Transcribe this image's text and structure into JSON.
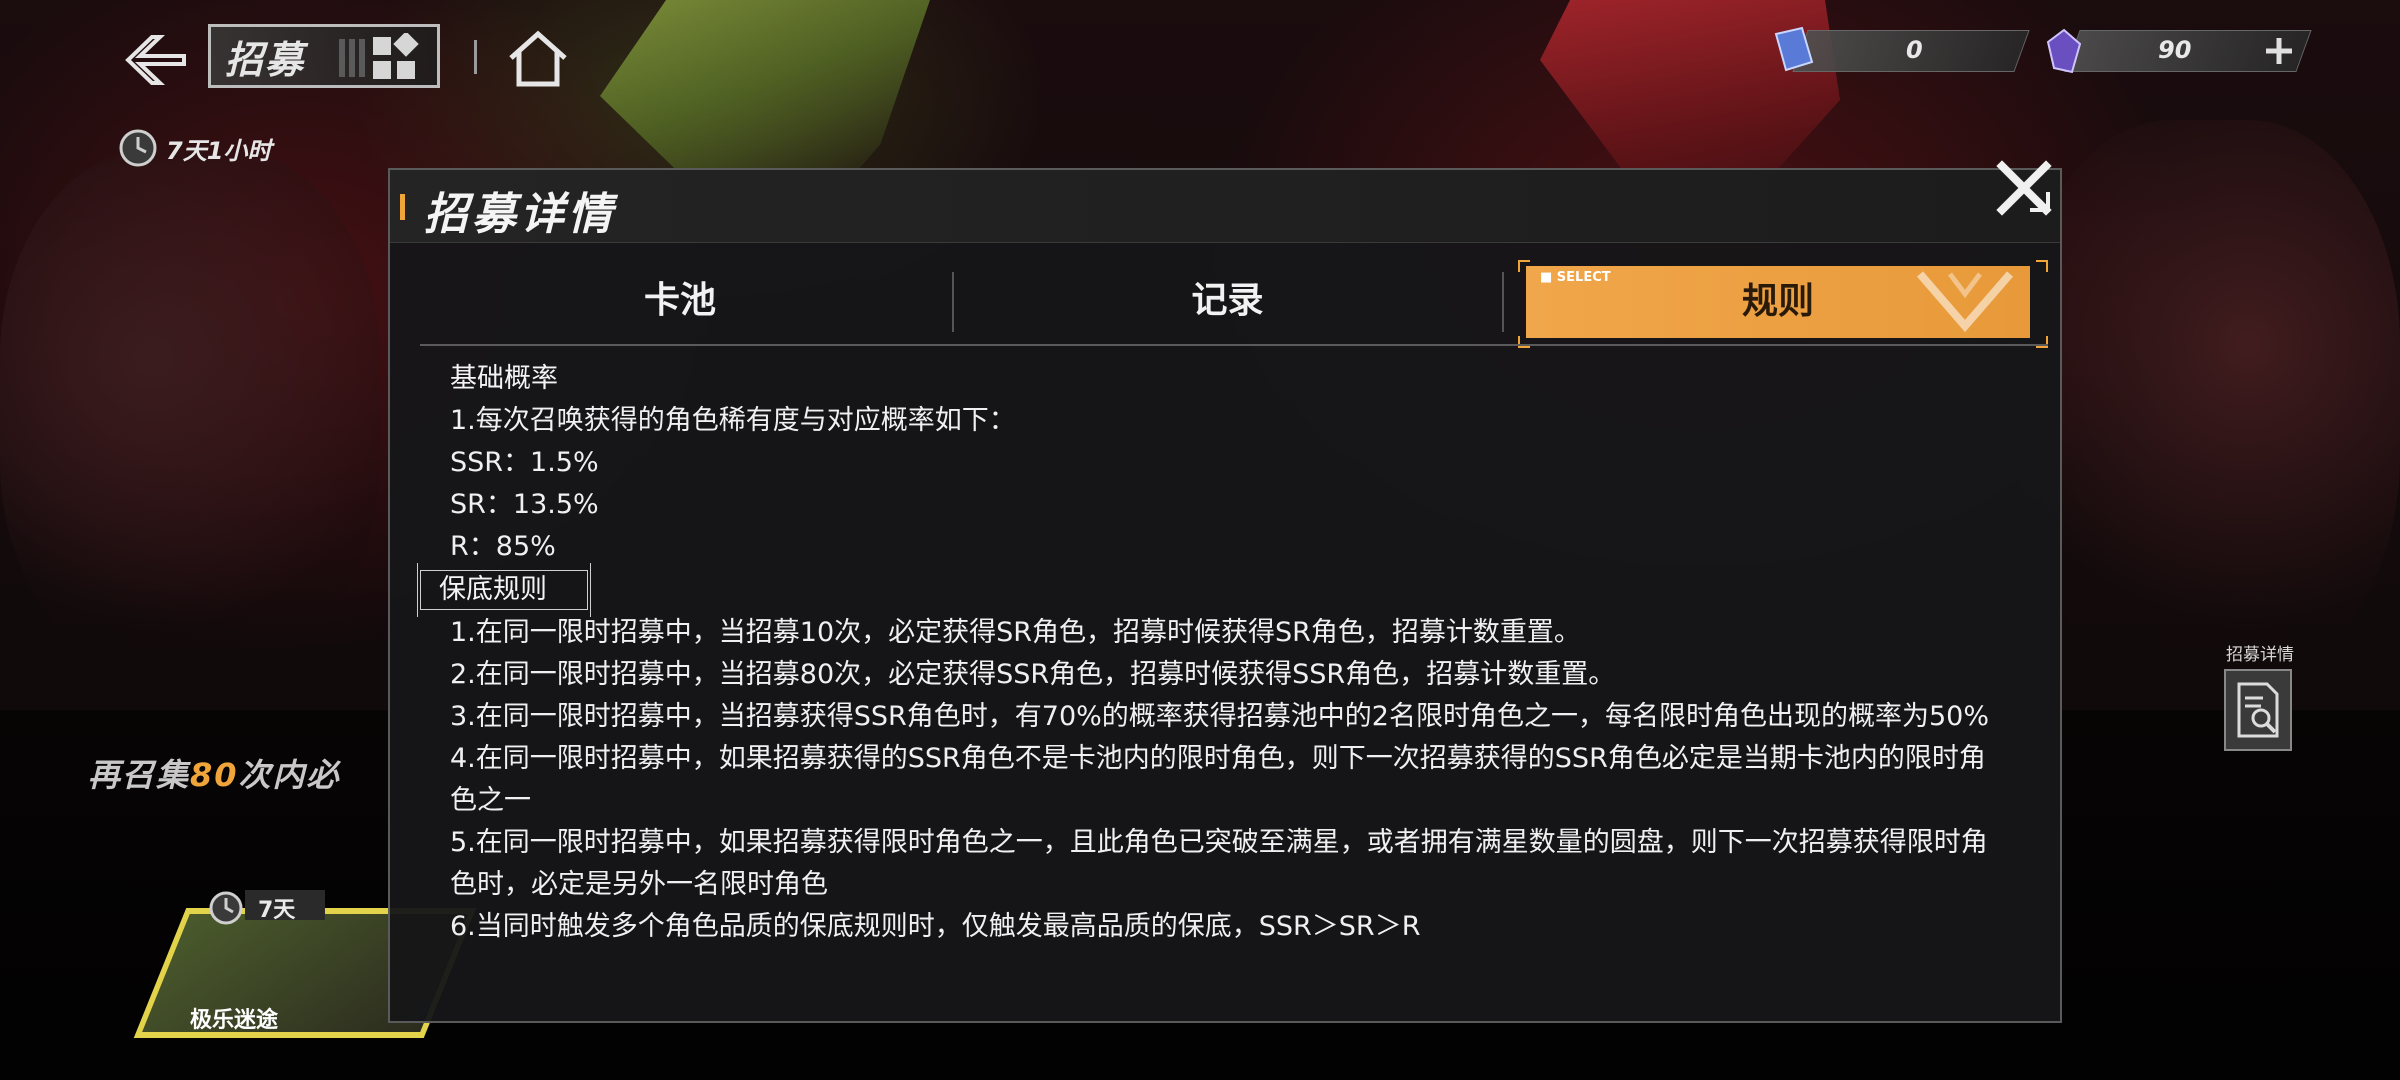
{
  "header": {
    "title": "招募",
    "timer": "7天1小时"
  },
  "currency": [
    {
      "icon": "ticket-icon",
      "value": "0"
    },
    {
      "icon": "crystal-icon",
      "value": "90"
    }
  ],
  "promo": {
    "prefix": "再召集",
    "number": "80",
    "suffix": "次内必",
    "days": "7天",
    "banner_name": "极乐迷途"
  },
  "side_button": {
    "label": "招募详情"
  },
  "modal": {
    "title": "招募详情",
    "tabs": [
      {
        "label": "卡池",
        "active": false
      },
      {
        "label": "记录",
        "active": false
      },
      {
        "label": "规则",
        "active": true,
        "select_label": "■ SELECT"
      }
    ],
    "sections": [
      {
        "heading": "基础概率",
        "lines": [
          "1.每次召唤获得的角色稀有度与对应概率如下：",
          "SSR：1.5%",
          "SR：13.5%",
          "R：85%"
        ]
      },
      {
        "heading": "保底规则",
        "lines": [
          "1.在同一限时招募中，当招募10次，必定获得SR角色，招募时候获得SR角色，招募计数重置。",
          "2.在同一限时招募中，当招募80次，必定获得SSR角色，招募时候获得SSR角色，招募计数重置。",
          "3.在同一限时招募中，当招募获得SSR角色时，有70%的概率获得招募池中的2名限时角色之一，每名限时角色出现的概率为50%",
          "4.在同一限时招募中，如果招募获得的SSR角色不是卡池内的限时角色，则下一次招募获得的SSR角色必定是当期卡池内的限时角色之一",
          "5.在同一限时招募中，如果招募获得限时角色之一，且此角色已突破至满星，或者拥有满星数量的圆盘，则下一次招募获得限时角色时，必定是另外一名限时角色",
          "6.当同时触发多个角色品质的保底规则时，仅触发最高品质的保底，SSR＞SR＞R"
        ]
      }
    ]
  }
}
